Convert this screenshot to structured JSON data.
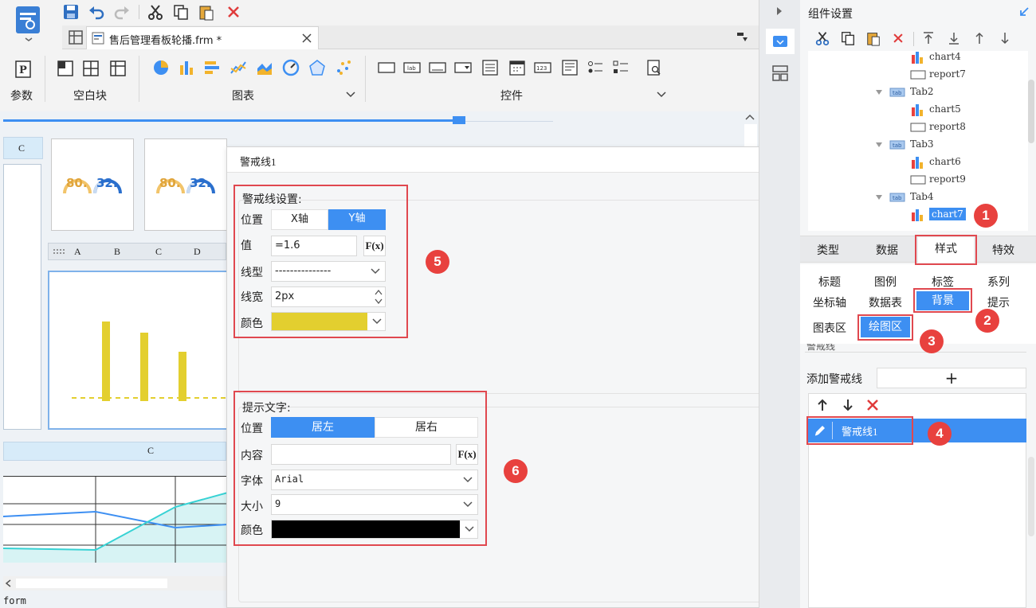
{
  "toolbar": {
    "tab_title": "售后管理看板轮播.frm *",
    "groups": {
      "param_label": "参数",
      "blank_label": "空白块",
      "chart_label": "图表",
      "control_label": "控件"
    }
  },
  "canvas": {
    "col_c_top": "C",
    "gauge1_a": "80.",
    "gauge1_b": "32.",
    "gauge2_a": "80.",
    "gauge2_b": "32.",
    "mini_cols": [
      "A",
      "B",
      "C",
      "D"
    ],
    "col_c_bottom": "C",
    "footer": "form"
  },
  "dialog": {
    "title": "警戒线1",
    "warn": {
      "heading": "警戒线设置:",
      "position_label": "位置",
      "pos_x": "X轴",
      "pos_y": "Y轴",
      "value_label": "值",
      "value": "=1.6",
      "fx": "F(x)",
      "linetype_label": "线型",
      "linetype": "---------------",
      "linewidth_label": "线宽",
      "linewidth": "2px",
      "color_label": "颜色",
      "color": "#e3cf2f"
    },
    "hint": {
      "heading": "提示文字:",
      "position_label": "位置",
      "pos_left": "居左",
      "pos_right": "居右",
      "content_label": "内容",
      "content": "",
      "fx": "F(x)",
      "font_label": "字体",
      "font": "Arial",
      "size_label": "大小",
      "size": "9",
      "color_label": "颜色",
      "color": "#000000"
    }
  },
  "right_panel": {
    "title": "组件设置",
    "tree": [
      {
        "label": "chart4",
        "type": "chart"
      },
      {
        "label": "report7",
        "type": "report"
      },
      {
        "label": "Tab2",
        "type": "tab"
      },
      {
        "label": "chart5",
        "type": "chart"
      },
      {
        "label": "report8",
        "type": "report"
      },
      {
        "label": "Tab3",
        "type": "tab"
      },
      {
        "label": "chart6",
        "type": "chart"
      },
      {
        "label": "report9",
        "type": "report"
      },
      {
        "label": "Tab4",
        "type": "tab"
      },
      {
        "label": "chart7",
        "type": "chart"
      }
    ],
    "tabs": [
      "类型",
      "数据",
      "样式",
      "特效"
    ],
    "sub_tabs_row1": [
      "标题",
      "图例",
      "标签",
      "系列"
    ],
    "sub_tabs_row2": [
      "坐标轴",
      "数据表",
      "背景",
      "提示"
    ],
    "area_tabs": [
      "图表区",
      "绘图区"
    ],
    "section_cut": "警戒线",
    "add_label": "添加警戒线",
    "add_plus": "+",
    "list_item": "警戒线1"
  },
  "badges": [
    "1",
    "2",
    "3",
    "4",
    "5",
    "6"
  ],
  "colors": {
    "accent": "#3d8ff2",
    "badge": "#e8413e",
    "callout": "#e0484f",
    "bar": "#e3cf2f"
  }
}
